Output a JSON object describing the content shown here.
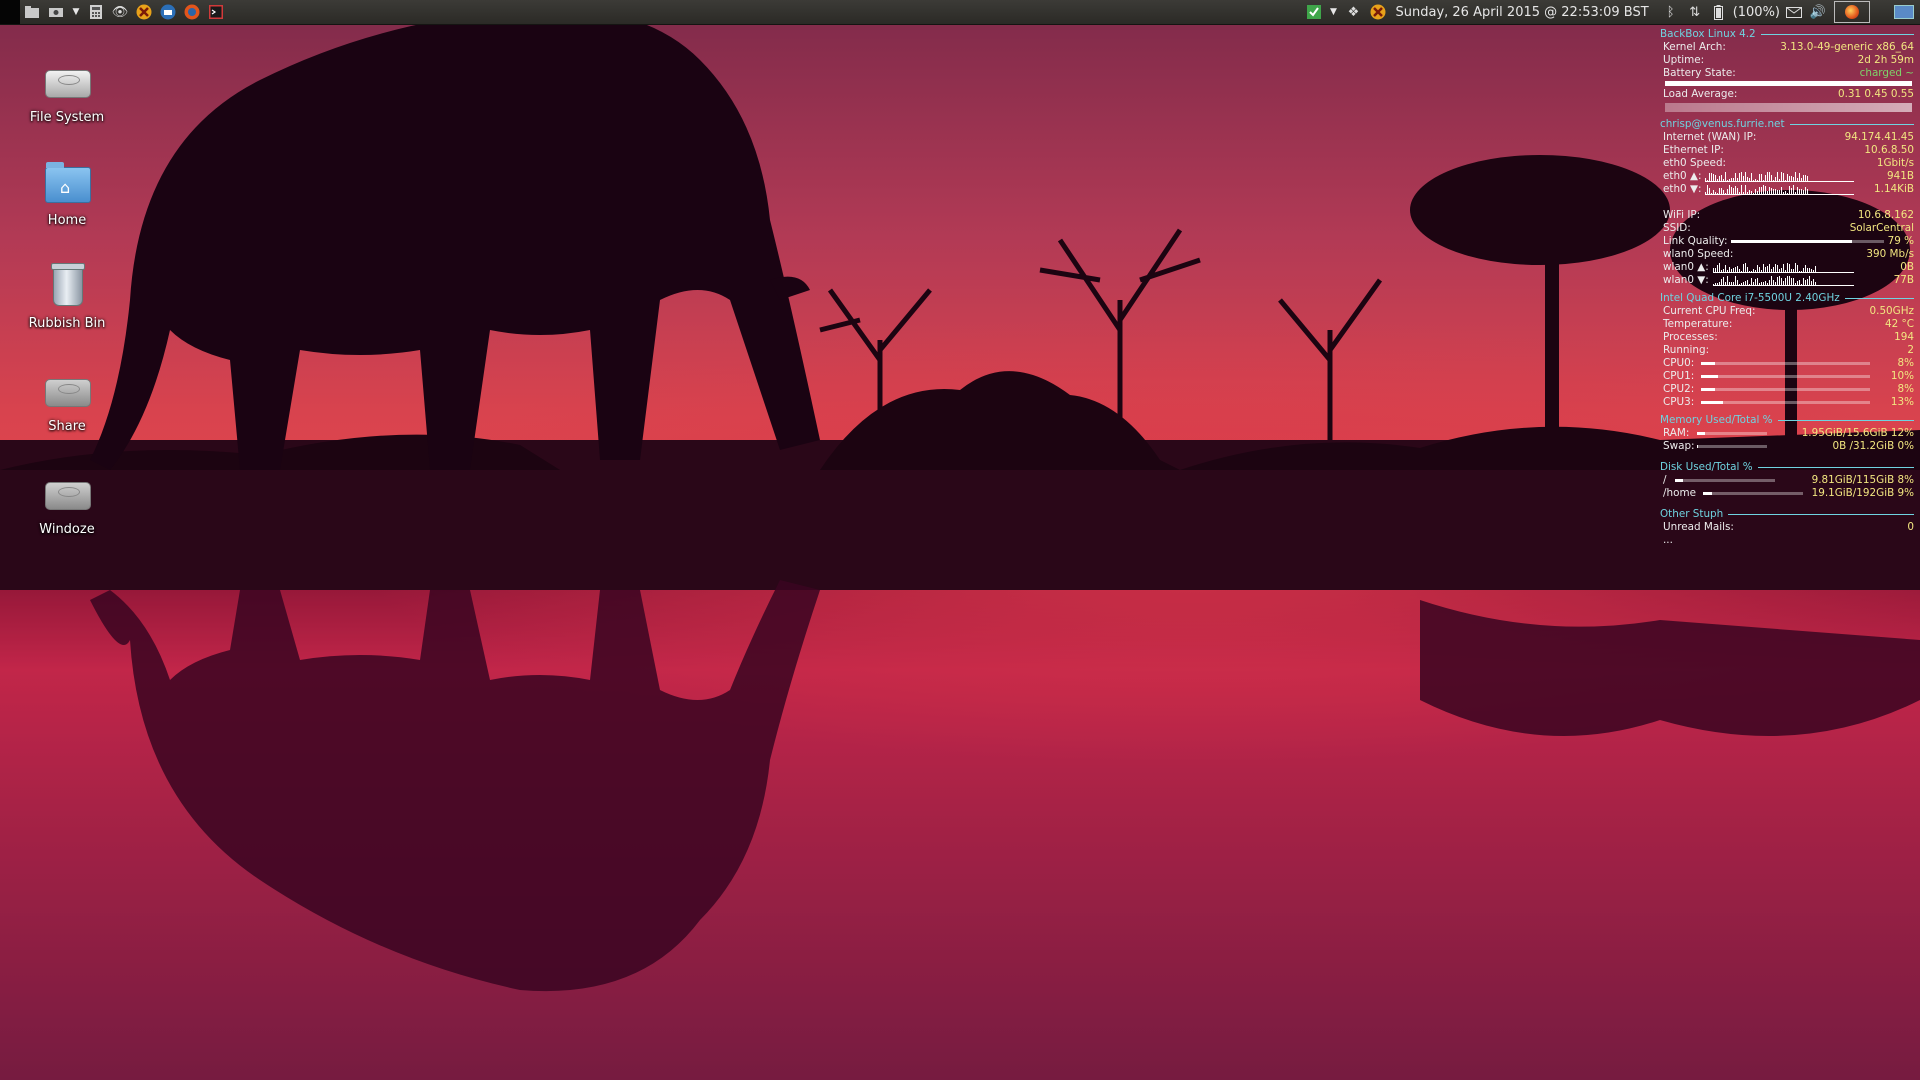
{
  "panel": {
    "clock": "Sunday, 26 April 2015 @ 22:53:09 BST",
    "battery_percent": "(100%)"
  },
  "desktop": {
    "icons": [
      {
        "label": "File System"
      },
      {
        "label": "Home"
      },
      {
        "label": "Rubbish Bin"
      },
      {
        "label": "Share"
      },
      {
        "label": "Windoze"
      }
    ]
  },
  "conky": {
    "system": {
      "header": "BackBox Linux 4.2",
      "kernel_label": "Kernel Arch:",
      "kernel_value": "3.13.0-49-generic x86_64",
      "uptime_label": "Uptime:",
      "uptime_value": "2d 2h 59m",
      "battery_label": "Battery State:",
      "battery_value": "charged ~",
      "load_label": "Load Average:",
      "load_value": "0.31 0.45 0.55"
    },
    "network": {
      "header": "chrisp@venus.furrie.net",
      "wan_label": "Internet (WAN) IP:",
      "wan_value": "94.174.41.45",
      "eth_ip_label": "Ethernet IP:",
      "eth_ip_value": "10.6.8.50",
      "eth_speed_label": "eth0 Speed:",
      "eth_speed_value": "1Gbit/s",
      "eth_up_label": "eth0 ▲:",
      "eth_up_value": "941B",
      "eth_down_label": "eth0 ▼:",
      "eth_down_value": "1.14KiB",
      "wifi_ip_label": "WiFi IP:",
      "wifi_ip_value": "10.6.8.162",
      "ssid_label": "SSID:",
      "ssid_value": "SolarCentral",
      "link_label": "Link Quality:",
      "link_value": "79  %",
      "link_fraction": 0.79,
      "wlan_speed_label": "wlan0 Speed:",
      "wlan_speed_value": "390 Mb/s",
      "wlan_up_label": "wlan0 ▲:",
      "wlan_up_value": "0B",
      "wlan_down_label": "wlan0 ▼:",
      "wlan_down_value": "77B"
    },
    "cpu": {
      "header": "Intel Quad Core i7-5500U 2.40GHz",
      "freq_label": "Current CPU Freq:",
      "freq_value": "0.50GHz",
      "temp_label": "Temperature:",
      "temp_value": "42 °C",
      "proc_label": "Processes:",
      "proc_value": "194",
      "running_label": "Running:",
      "running_value": "2",
      "cores": [
        {
          "label": "CPU0:",
          "value": "8%",
          "fraction": 0.08
        },
        {
          "label": "CPU1:",
          "value": "10%",
          "fraction": 0.1
        },
        {
          "label": "CPU2:",
          "value": "8%",
          "fraction": 0.08
        },
        {
          "label": "CPU3:",
          "value": "13%",
          "fraction": 0.13
        }
      ]
    },
    "memory": {
      "header": "Memory Used/Total %",
      "ram_label": "RAM:",
      "ram_value": "1.95GiB/15.6GiB 12%",
      "ram_fraction": 0.12,
      "swap_label": "Swap:",
      "swap_value": "0B   /31.2GiB 0%",
      "swap_fraction": 0.0
    },
    "disk": {
      "header": "Disk Used/Total %",
      "root_label": "/",
      "root_value": "9.81GiB/115GiB  8%",
      "root_fraction": 0.08,
      "home_label": "/home",
      "home_value": "19.1GiB/192GiB  9%",
      "home_fraction": 0.09
    },
    "other": {
      "header": "Other Stuph",
      "mail_label": "Unread Mails:",
      "mail_value": "0",
      "more": "..."
    }
  },
  "colors": {
    "conky_header": "#6fd3e0",
    "conky_value": "#f2e680",
    "conky_green": "#7fd36a"
  }
}
